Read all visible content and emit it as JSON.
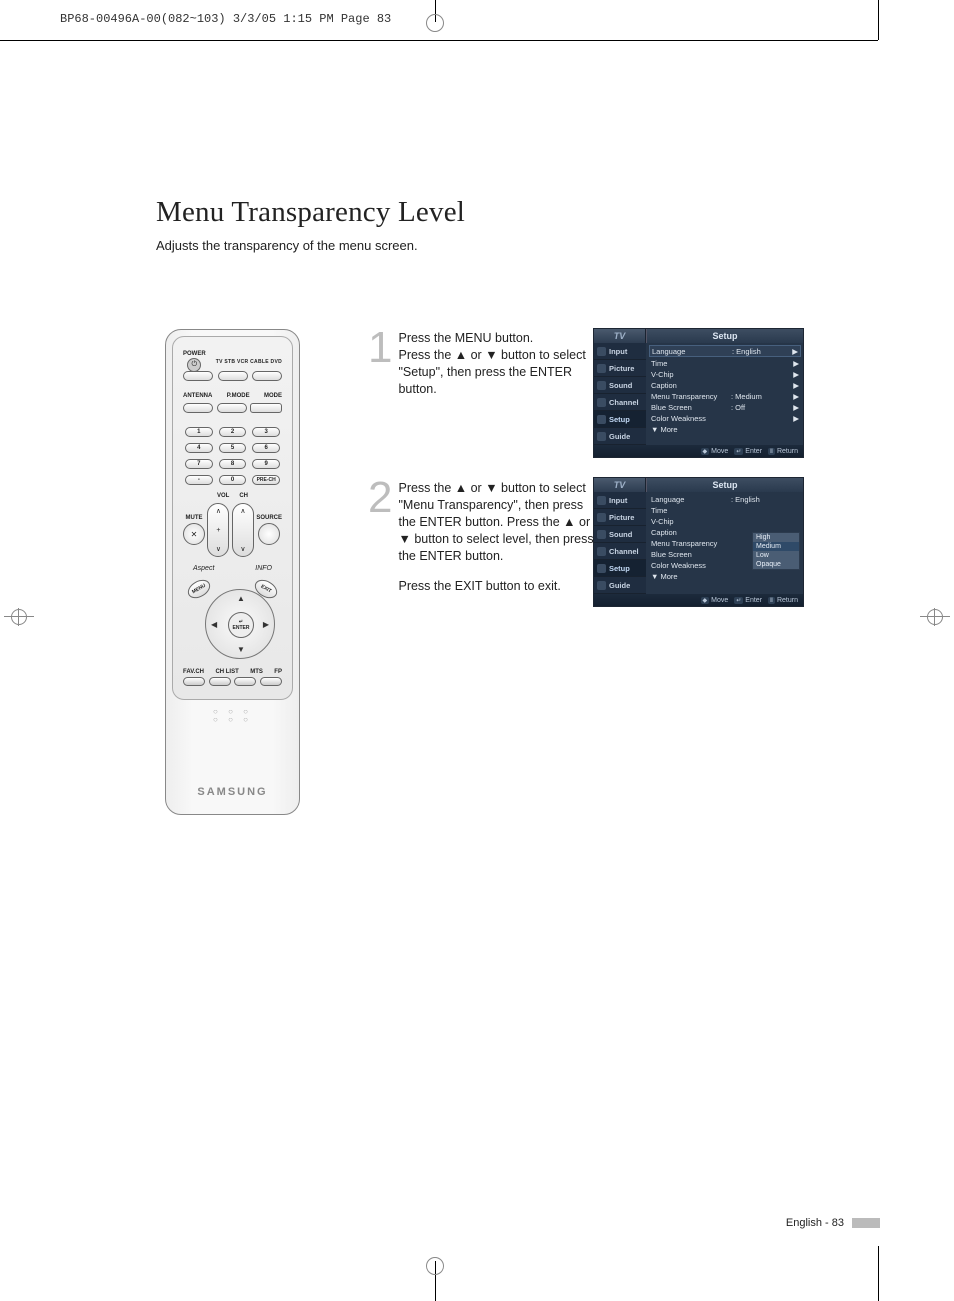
{
  "header": "BP68-00496A-00(082~103)  3/3/05  1:15 PM  Page 83",
  "title": "Menu Transparency Level",
  "subtitle": "Adjusts the transparency of the menu screen.",
  "steps": {
    "s1": {
      "num": "1",
      "text": "Press the MENU button.\nPress the ▲ or ▼ button to select \"Setup\", then press the ENTER button."
    },
    "s2": {
      "num": "2",
      "text": "Press the ▲ or ▼ button to select \"Menu Transparency\", then press the ENTER button. Press the ▲ or ▼ button to select level, then press the ENTER button.",
      "exit": "Press the EXIT button to exit."
    }
  },
  "remote": {
    "power": "POWER",
    "topmodes": "TV  STB  VCR  CABLE  DVD",
    "row2": [
      "ANTENNA",
      "P.MODE",
      "MODE"
    ],
    "nums": [
      "1",
      "2",
      "3",
      "4",
      "5",
      "6",
      "7",
      "8",
      "9",
      "-",
      "0",
      "PRE-CH"
    ],
    "vol": "VOL",
    "ch": "CH",
    "mute": "MUTE",
    "source": "SOURCE",
    "aspect": "Aspect",
    "info": "INFO",
    "menu": "MENU",
    "exit": "EXIT",
    "enter": "ENTER",
    "enter2": "↵",
    "bottom": [
      "FAV.CH",
      "CH LIST",
      "MTS",
      "FP"
    ],
    "brand": "SAMSUNG"
  },
  "osd": {
    "tv": "TV",
    "setup": "Setup",
    "sidebar": [
      "Input",
      "Picture",
      "Sound",
      "Channel",
      "Setup",
      "Guide"
    ],
    "items1": [
      {
        "lab": "Language",
        "val": ": English",
        "arr": "▶",
        "boxed": true
      },
      {
        "lab": "Time",
        "val": "",
        "arr": "▶"
      },
      {
        "lab": "V-Chip",
        "val": "",
        "arr": "▶"
      },
      {
        "lab": "Caption",
        "val": "",
        "arr": "▶"
      },
      {
        "lab": "Menu Transparency",
        "val": ": Medium",
        "arr": "▶"
      },
      {
        "lab": "Blue Screen",
        "val": ": Off",
        "arr": "▶"
      },
      {
        "lab": "Color Weakness",
        "val": "",
        "arr": "▶"
      }
    ],
    "items2": [
      {
        "lab": "Language",
        "val": ": English",
        "arr": ""
      },
      {
        "lab": "Time",
        "val": "",
        "arr": ""
      },
      {
        "lab": "V-Chip",
        "val": "",
        "arr": ""
      },
      {
        "lab": "Caption",
        "val": "",
        "arr": ""
      },
      {
        "lab": "Menu Transparency",
        "val": "",
        "arr": ""
      },
      {
        "lab": "Blue Screen",
        "val": "",
        "arr": ""
      },
      {
        "lab": "Color Weakness",
        "val": "",
        "arr": ""
      }
    ],
    "dropdown": [
      "High",
      "Medium",
      "Low",
      "Opaque"
    ],
    "dropdown_sel": "Medium",
    "more": "▼ More",
    "footer": {
      "move": "Move",
      "enter": "Enter",
      "return": "Return"
    }
  },
  "footer": {
    "label": "English - 83"
  }
}
